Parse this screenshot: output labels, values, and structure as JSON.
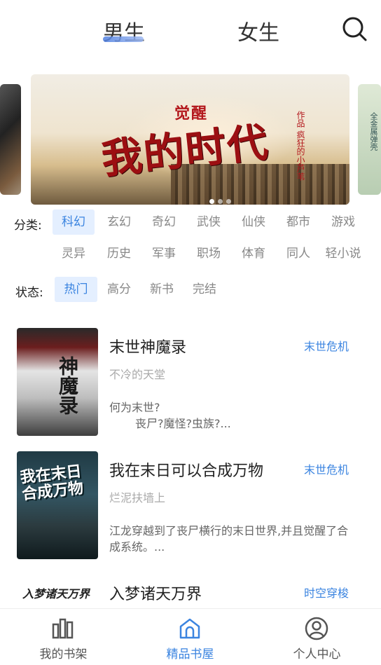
{
  "header": {
    "tabs": [
      {
        "label": "男生",
        "active": true
      },
      {
        "label": "女生",
        "active": false
      }
    ],
    "search_icon": "search-icon"
  },
  "banner": {
    "title_small": "觉醒",
    "title_big": "我的时代",
    "author_note": "作品 疯狂的小芦苇",
    "right_card_text": "全金属弹壳",
    "dots": 3,
    "active_dot": 0
  },
  "filters": {
    "category_label": "分类:",
    "categories": [
      "科幻",
      "玄幻",
      "奇幻",
      "武侠",
      "仙侠",
      "都市",
      "游戏",
      "灵异",
      "历史",
      "军事",
      "职场",
      "体育",
      "同人",
      "轻小说"
    ],
    "category_active": "科幻",
    "status_label": "状态:",
    "statuses": [
      "热门",
      "高分",
      "新书",
      "完结"
    ],
    "status_active": "热门"
  },
  "books": [
    {
      "title": "末世神魔录",
      "tag": "末世危机",
      "author": "不冷的天堂",
      "desc_line1": "何为末世?",
      "desc_line2": "丧尸?魔怪?虫族?...",
      "cover_text": "神魔录"
    },
    {
      "title": "我在末日可以合成万物",
      "tag": "末世危机",
      "author": "烂泥扶墙上",
      "desc": "江龙穿越到了丧尸横行的末日世界,并且觉醒了合成系统。...",
      "cover_text_1": "我在末日",
      "cover_text_2": "合成万物"
    },
    {
      "title": "入梦诸天万界",
      "tag": "时空穿梭",
      "cover_text": "入梦诸天万界"
    }
  ],
  "bottom_nav": [
    {
      "label": "我的书架",
      "icon": "bookshelf-icon",
      "active": false
    },
    {
      "label": "精品书屋",
      "icon": "house-icon",
      "active": true
    },
    {
      "label": "个人中心",
      "icon": "user-icon",
      "active": false
    }
  ],
  "colors": {
    "accent": "#3b84e0",
    "chip_active_bg": "#e4efff",
    "text_muted": "#888888"
  }
}
